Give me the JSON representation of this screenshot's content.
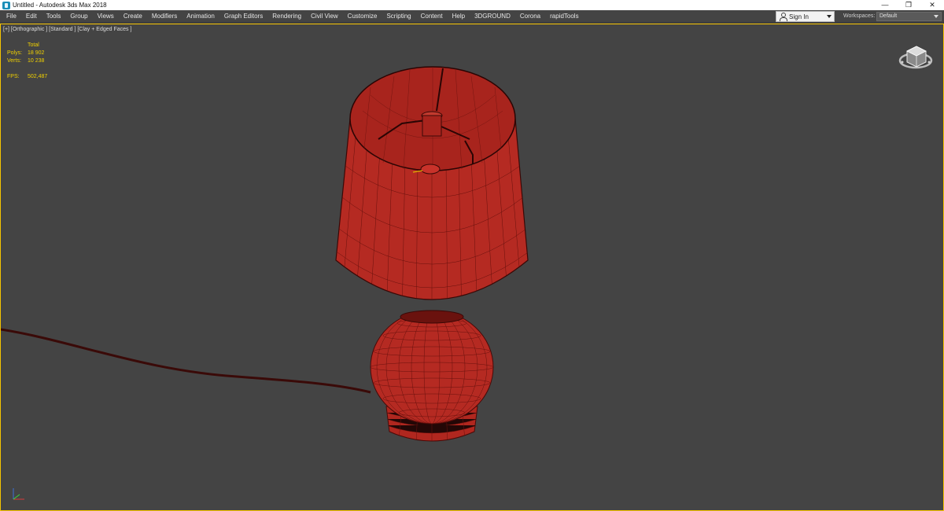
{
  "window": {
    "title": "Untitled - Autodesk 3ds Max 2018",
    "controls": {
      "minimize": "—",
      "restore": "❐",
      "close": "✕"
    }
  },
  "menu": {
    "items": [
      "File",
      "Edit",
      "Tools",
      "Group",
      "Views",
      "Create",
      "Modifiers",
      "Animation",
      "Graph Editors",
      "Rendering",
      "Civil View",
      "Customize",
      "Scripting",
      "Content",
      "Help",
      "3DGROUND",
      "Corona",
      "rapidTools"
    ],
    "sign_in": "Sign In",
    "workspaces_label": "Workspaces:",
    "workspaces_value": "Default"
  },
  "viewport": {
    "label": "[+] [Orthographic ] [Standard ] [Clay + Edged Faces ]",
    "stats": {
      "header": "Total",
      "polys_label": "Polys:",
      "polys_value": "18 902",
      "verts_label": "Verts:",
      "verts_value": "10 238",
      "fps_label": "FPS:",
      "fps_value": "502,487"
    }
  },
  "colors": {
    "viewport_bg": "#444444",
    "active_border": "#f5c400",
    "model_fill": "#b52a22",
    "wire": "#5a0d0a",
    "stats_text": "#f0d000"
  },
  "icons": [
    "app-icon",
    "user-icon",
    "viewcube-icon",
    "axis-gizmo-icon"
  ]
}
